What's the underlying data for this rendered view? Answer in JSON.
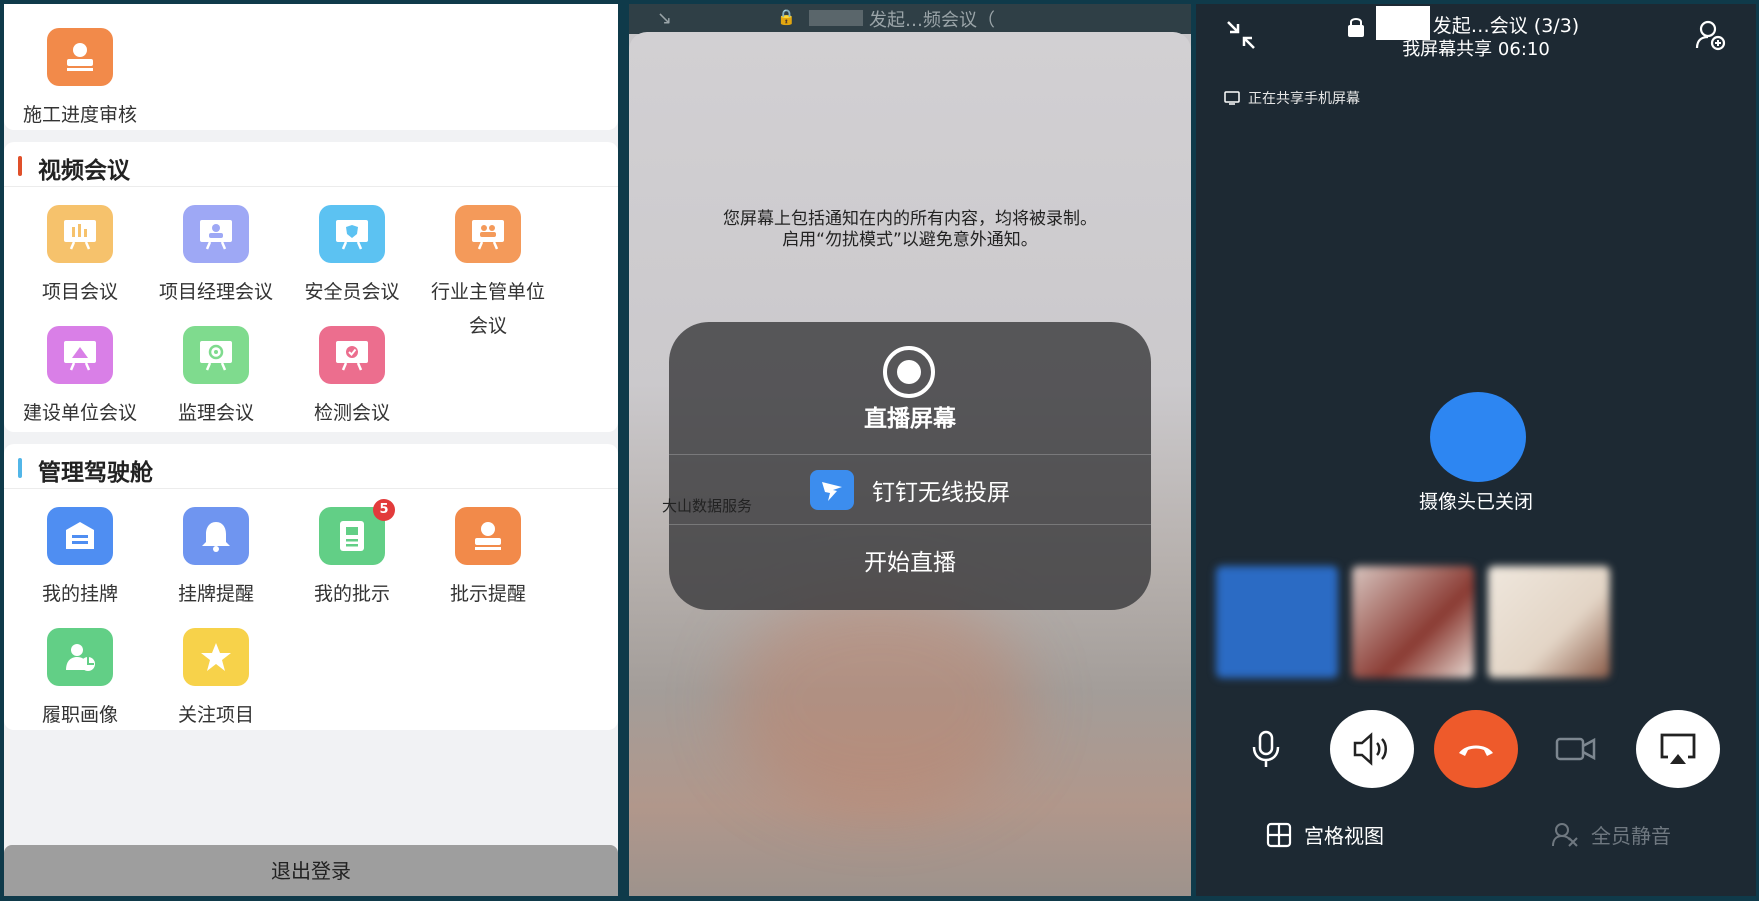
{
  "left": {
    "top_item": {
      "label": "施工进度审核",
      "color": "#f28a4a"
    },
    "video_meeting": {
      "title": "视频会议",
      "bar_color": "#e0502a",
      "items": [
        {
          "label": "项目会议",
          "color": "#f6c26c",
          "icon": "chart-board-icon"
        },
        {
          "label": "项目经理会议",
          "color": "#9ea8f5",
          "icon": "presenter-icon"
        },
        {
          "label": "安全员会议",
          "color": "#5cc2f2",
          "icon": "shield-board-icon"
        },
        {
          "label": "行业主管单位",
          "label2": "会议",
          "color": "#f49a5a",
          "icon": "people-board-icon"
        },
        {
          "label": "建设单位会议",
          "color": "#d97fe7",
          "icon": "building-board-icon"
        },
        {
          "label": "监理会议",
          "color": "#7fdb8e",
          "icon": "eye-board-icon"
        },
        {
          "label": "检测会议",
          "color": "#ec6e8e",
          "icon": "check-board-icon"
        }
      ]
    },
    "cockpit": {
      "title": "管理驾驶舱",
      "bar_color": "#52b6e8",
      "items": [
        {
          "label": "我的挂牌",
          "color": "#4f8ef2",
          "icon": "plaque-icon"
        },
        {
          "label": "挂牌提醒",
          "color": "#6f95f0",
          "icon": "bell-icon"
        },
        {
          "label": "我的批示",
          "color": "#62cf86",
          "icon": "document-icon",
          "badge": "5"
        },
        {
          "label": "批示提醒",
          "color": "#f28a4a",
          "icon": "stamp-icon"
        },
        {
          "label": "履职画像",
          "color": "#62cf86",
          "icon": "profile-icon"
        },
        {
          "label": "关注项目",
          "color": "#f7d24a",
          "icon": "star-icon"
        }
      ]
    },
    "logout_label": "退出登录"
  },
  "middle": {
    "top_title": "发起…频会议（",
    "notice_line1": "您屏幕上包括通知在内的所有内容，均将被录制。",
    "notice_line2": "启用“勿扰模式”以避免意外通知。",
    "dialog_title": "直播屏幕",
    "option_dingtalk": "钉钉无线投屏",
    "option_start": "开始直播",
    "watermark": "大山数据服务"
  },
  "right": {
    "title": "发起…会议 (3/3)",
    "subtitle": "我屏幕共享  06:10",
    "sharing_label": "正在共享手机屏幕",
    "camera_off": "摄像头已关闭",
    "grid_view": "宫格视图",
    "mute_all": "全员静音",
    "avatar_color": "#2d86f2",
    "hangup_color": "#ee5a2b"
  }
}
